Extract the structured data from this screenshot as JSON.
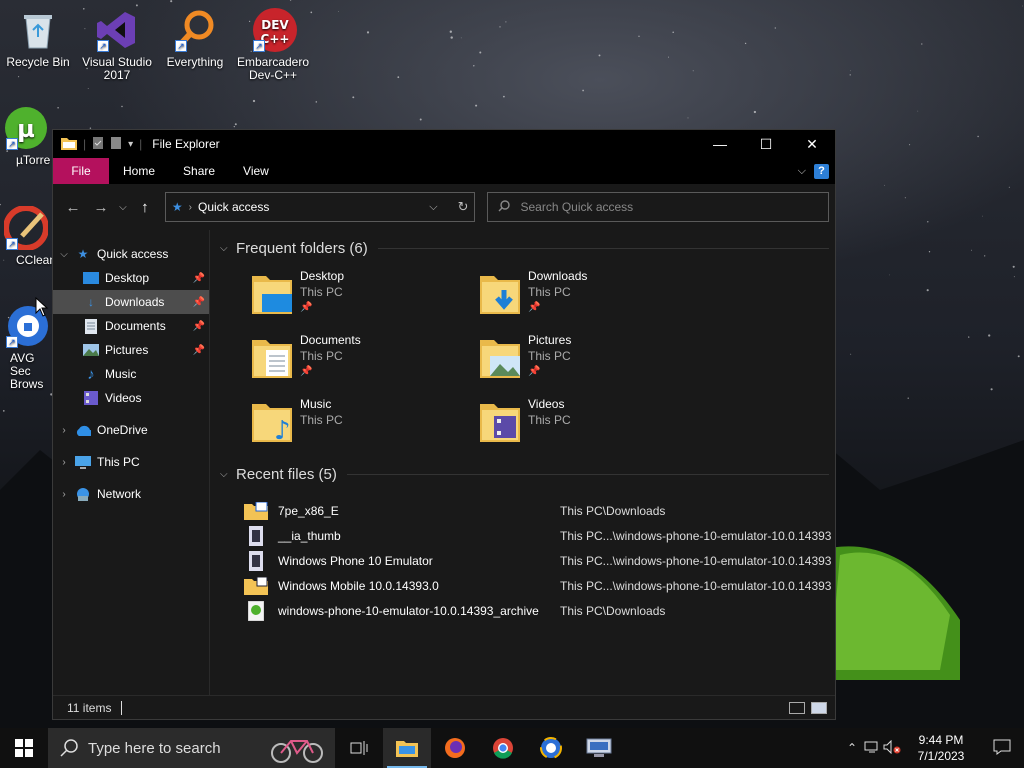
{
  "desktop": {
    "icons": [
      {
        "label": "Recycle Bin"
      },
      {
        "label": "Visual Studio 2017"
      },
      {
        "label": "Everything"
      },
      {
        "label": "Embarcadero Dev-C++"
      },
      {
        "label": "µTorre"
      },
      {
        "label": "CClean"
      },
      {
        "label": "AVG Sec Brows"
      }
    ]
  },
  "window": {
    "title": "File Explorer",
    "ribbon": {
      "file": "File",
      "home": "Home",
      "share": "Share",
      "view": "View"
    },
    "address": {
      "location": "Quick access"
    },
    "search": {
      "placeholder": "Search Quick access"
    },
    "nav": {
      "quick_access": "Quick access",
      "items": [
        {
          "label": "Desktop",
          "pinned": true
        },
        {
          "label": "Downloads",
          "pinned": true,
          "selected": true
        },
        {
          "label": "Documents",
          "pinned": true
        },
        {
          "label": "Pictures",
          "pinned": true
        },
        {
          "label": "Music",
          "pinned": false
        },
        {
          "label": "Videos",
          "pinned": false
        }
      ],
      "onedrive": "OneDrive",
      "thispc": "This PC",
      "network": "Network"
    },
    "frequent": {
      "header": "Frequent folders (6)",
      "folders": [
        {
          "name": "Desktop",
          "location": "This PC",
          "pinned": true
        },
        {
          "name": "Downloads",
          "location": "This PC",
          "pinned": true
        },
        {
          "name": "Documents",
          "location": "This PC",
          "pinned": true
        },
        {
          "name": "Pictures",
          "location": "This PC",
          "pinned": true
        },
        {
          "name": "Music",
          "location": "This PC",
          "pinned": false
        },
        {
          "name": "Videos",
          "location": "This PC",
          "pinned": false
        }
      ]
    },
    "recent": {
      "header": "Recent files (5)",
      "files": [
        {
          "name": "7pe_x86_E",
          "path": "This PC\\Downloads",
          "icon": "iso-file-icon"
        },
        {
          "name": "__ia_thumb",
          "path": "This PC...\\windows-phone-10-emulator-10.0.14393",
          "icon": "image-file-icon"
        },
        {
          "name": "Windows Phone 10 Emulator",
          "path": "This PC...\\windows-phone-10-emulator-10.0.14393",
          "icon": "image-file-icon"
        },
        {
          "name": "Windows Mobile 10.0.14393.0",
          "path": "This PC...\\windows-phone-10-emulator-10.0.14393",
          "icon": "zip-file-icon"
        },
        {
          "name": "windows-phone-10-emulator-10.0.14393_archive",
          "path": "This PC\\Downloads",
          "icon": "torrent-file-icon"
        }
      ]
    },
    "status": {
      "items": "11 items"
    }
  },
  "taskbar": {
    "search_placeholder": "Type here to search",
    "time": "9:44 PM",
    "date": "7/1/2023"
  },
  "colors": {
    "file_tab": "#b4115d",
    "accent": "#76b9ed"
  }
}
